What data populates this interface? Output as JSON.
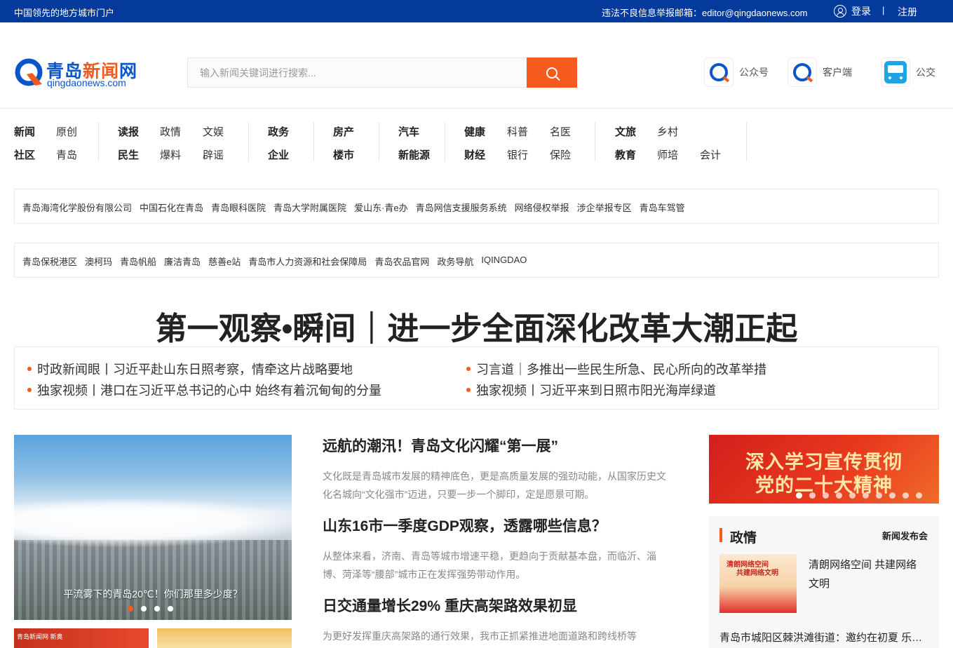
{
  "topbar": {
    "slogan": "中国领先的地方城市门户",
    "report": "违法不良信息举报邮箱：editor@qingdaonews.com",
    "login": "登录",
    "separator": "|",
    "register": "注册"
  },
  "logo": {
    "cn_blue": "青岛",
    "cn_orange": "新闻",
    "cn_blue2": "网",
    "en": "qingdaonews.com"
  },
  "search": {
    "placeholder": "输入新闻关键词进行搜索..."
  },
  "quick_links": [
    {
      "label": "公众号",
      "icon": "qingdaonews-logo-icon"
    },
    {
      "label": "客户端",
      "icon": "qingdaonews-app-icon"
    },
    {
      "label": "公交",
      "icon": "bus-icon"
    }
  ],
  "nav": {
    "groups": [
      {
        "items": [
          [
            "新闻",
            "原创"
          ],
          [
            "社区",
            "青岛"
          ]
        ]
      },
      {
        "items": [
          [
            "读报",
            "政情",
            "文娱"
          ],
          [
            "民生",
            "爆料",
            "辟谣"
          ]
        ]
      },
      {
        "items": [
          [
            "政务"
          ],
          [
            "企业"
          ]
        ]
      },
      {
        "items": [
          [
            "房产"
          ],
          [
            "楼市"
          ]
        ]
      },
      {
        "items": [
          [
            "汽车"
          ],
          [
            "新能源"
          ]
        ]
      },
      {
        "items": [
          [
            "健康",
            "科普",
            "名医"
          ],
          [
            "财经",
            "银行",
            "保险"
          ]
        ]
      },
      {
        "items": [
          [
            "文旅",
            "乡村"
          ],
          [
            "教育",
            "师培",
            "会计"
          ]
        ]
      }
    ]
  },
  "link_rows": [
    [
      "青岛海湾化学股份有限公司",
      "中国石化在青岛",
      "青岛眼科医院",
      "青岛大学附属医院",
      "爱山东·青e办",
      "青岛网信支援服务系统",
      "网络侵权举报",
      "涉企举报专区",
      "青岛车驾管"
    ],
    [
      "青岛保税港区",
      "澳柯玛",
      "青岛帆船",
      "廉洁青岛",
      "慈善e站",
      "青岛市人力资源和社会保障局",
      "青岛农品官网",
      "政务导航",
      "IQINGDAO"
    ]
  ],
  "headline": "第一观察•瞬间｜进一步全面深化改革大潮正起",
  "sub_news": [
    "时政新闻眼丨习近平赴山东日照考察，情牵这片战略要地",
    "独家视频丨港口在习近平总书记的心中 始终有着沉甸甸的分量",
    "习言道｜多推出一些民生所急、民心所向的改革举措",
    "独家视频丨习近平来到日照市阳光海岸绿道"
  ],
  "carousel": {
    "caption": "平流雾下的青岛20℃！你们那里多少度？",
    "slides": 4,
    "active": 0
  },
  "thumbs": {
    "first_label": "青岛新闻网 新奥"
  },
  "articles": [
    {
      "title": "远航的潮汛！青岛文化闪耀“第一展”",
      "desc": "文化既是青岛城市发展的精神底色，更是高质量发展的强劲动能，从国家历史文化名城向“文化强市”迈进，只要一步一个脚印，定是愿景可期。"
    },
    {
      "title": "山东16市一季度GDP观察，透露哪些信息？",
      "desc": "从整体来看，济南、青岛等城市增速平稳，更趋向于贡献基本盘，而临沂、淄博、菏泽等“腰部”城市正在发挥强势带动作用。"
    },
    {
      "title": "日交通量增长29% 重庆高架路效果初显",
      "desc": "为更好发挥重庆高架路的通行效果，我市正抓紧推进地面道路和跨线桥等"
    }
  ],
  "banner": {
    "line1": "深入学习宣传贯彻",
    "line2": "党的二十大精神",
    "slides": 10,
    "active": 0
  },
  "panel": {
    "title": "政情",
    "more": "新闻发布会",
    "img_line1": "清朗网络空间",
    "img_line2": "共建网络文明",
    "feature": "清朗网络空间 共建网络文明",
    "footer": "青岛市城阳区棘洪滩街道：邀约在初夏 乐享..."
  }
}
